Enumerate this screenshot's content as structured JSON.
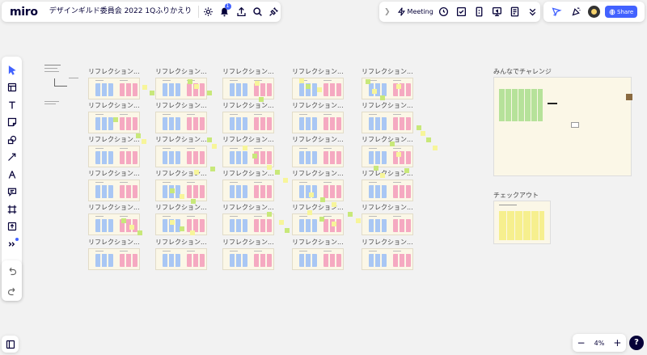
{
  "app": {
    "logo": "miro",
    "board_title": "デザインギルド委員会 2022 1Qふりかえり"
  },
  "toolbar_top": {
    "icons": [
      "gear-icon",
      "bell-icon",
      "upload-icon",
      "search-icon",
      "plugin-icon"
    ],
    "notification_count": "1"
  },
  "collab_bar": {
    "meeting_label": "Meeting"
  },
  "share": {
    "label": "Share"
  },
  "zoom": {
    "level": "4%",
    "minus": "−",
    "plus": "+"
  },
  "help": {
    "label": "?"
  },
  "frames": {
    "reflection_title": "リフレクション...",
    "challenge_title": "みんなでチャレンジ",
    "checkout_title": "チェックアウト"
  },
  "colors": {
    "accent": "#4262ff",
    "frame_bg": "#fbf7e7",
    "sticky_green": "#c8e87a",
    "sticky_yellow": "#f7f59a",
    "sticky_purple": "#c7a0e8"
  }
}
